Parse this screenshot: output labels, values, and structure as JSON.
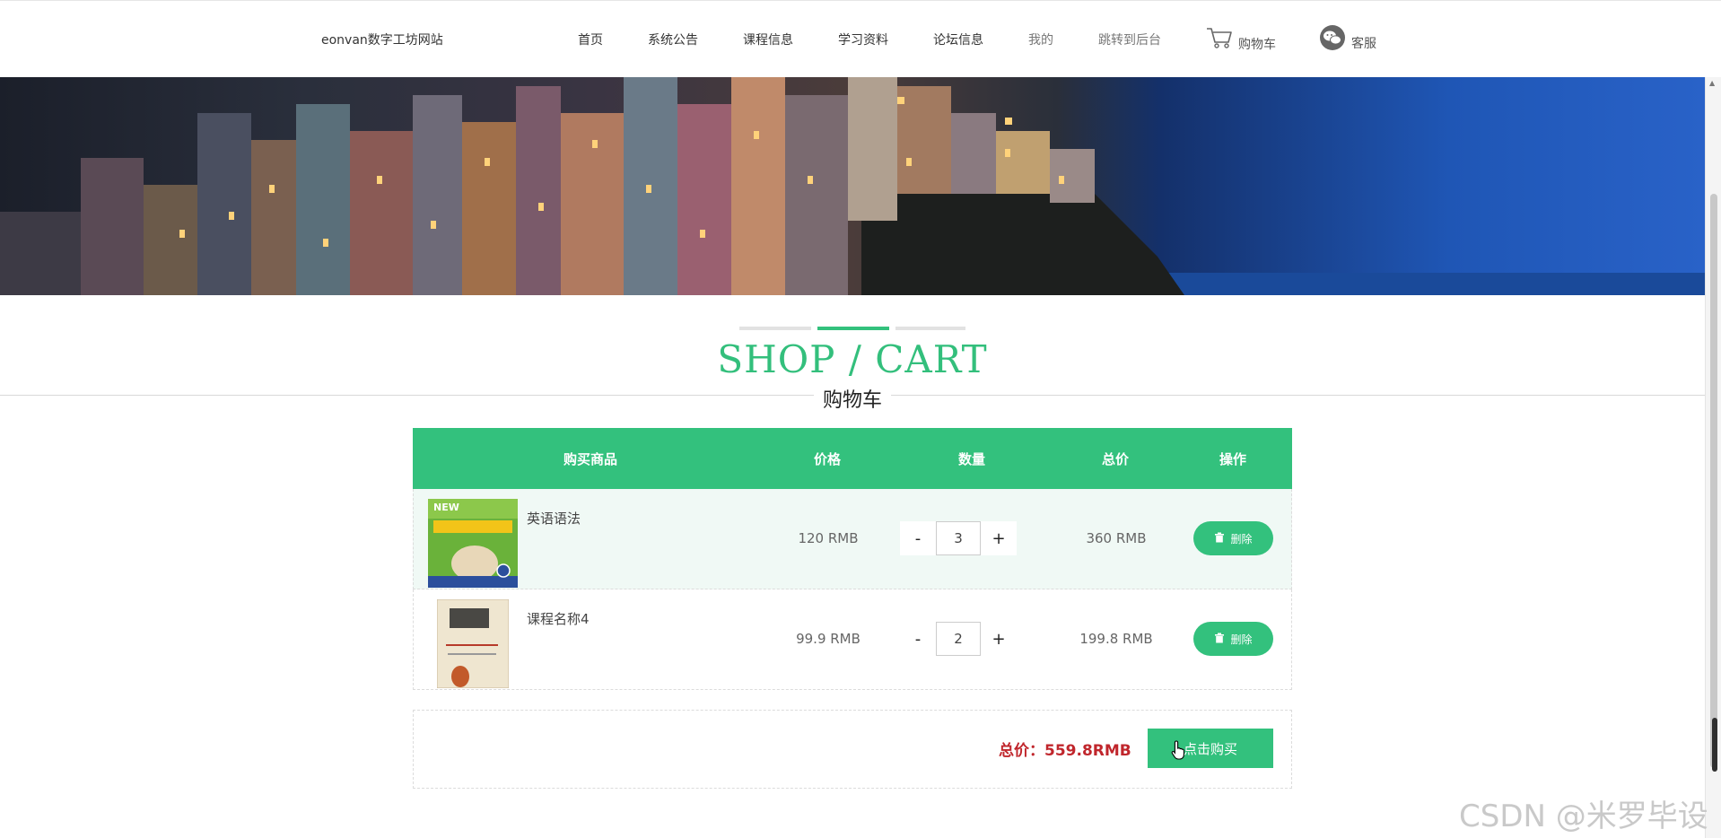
{
  "brand": "eonvan数字工坊网站",
  "nav": {
    "home": "首页",
    "notice": "系统公告",
    "courses": "课程信息",
    "materials": "学习资料",
    "forum": "论坛信息",
    "mine": "我的",
    "backend": "跳转到后台",
    "cart": "购物车",
    "service": "客服"
  },
  "section": {
    "title": "SHOP / CART",
    "subtitle": "购物车"
  },
  "table": {
    "headers": {
      "product": "购买商品",
      "price": "价格",
      "quantity": "数量",
      "total": "总价",
      "action": "操作"
    },
    "rows": [
      {
        "name": "英语语法",
        "price": "120 RMB",
        "qty": "3",
        "total": "360 RMB",
        "delete": "删除"
      },
      {
        "name": "课程名称4",
        "price": "99.9 RMB",
        "qty": "2",
        "total": "199.8 RMB",
        "delete": "删除"
      }
    ],
    "minus": "-",
    "plus": "+"
  },
  "summary": {
    "total_label": "总价：559.8RMB",
    "buy_button": "点击购买"
  },
  "watermark": "CSDN @米罗毕设",
  "colors": {
    "accent": "#33c17d",
    "total_red": "#c0262c"
  }
}
